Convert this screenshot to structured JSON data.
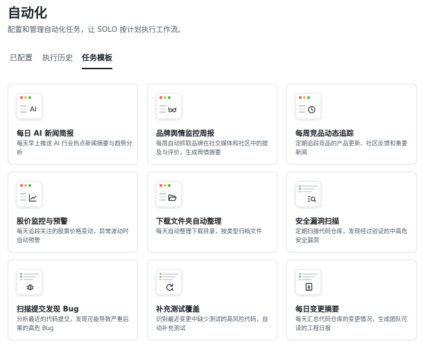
{
  "page": {
    "title": "自动化",
    "description": "配置和管理自动化任务，让 SOLO 按计划执行工作流。"
  },
  "tabs": [
    {
      "label": "已配置",
      "active": false
    },
    {
      "label": "执行历史",
      "active": false
    },
    {
      "label": "任务模板",
      "active": true
    }
  ],
  "templates": [
    {
      "title": "每日 AI 新闻简报",
      "description": "每天早上推送 AI 行业热点新闻摘要与趋势分析",
      "icon": "ai-text-icon",
      "icon_text": "AI"
    },
    {
      "title": "品牌舆情监控周报",
      "description": "每周自动抓取品牌在社交媒体和社区中的提及与评价，生成舆情摘要",
      "icon": "glasses-icon"
    },
    {
      "title": "每周竞品动态追踪",
      "description": "定期追踪竞品的产品更新、社区反馈和重要新闻",
      "icon": "target-icon"
    },
    {
      "title": "股价监控与预警",
      "description": "每天追踪关注的股票价格变动，异常波动时自动预警",
      "icon": "chart-line-icon"
    },
    {
      "title": "下载文件夹自动整理",
      "description": "每天自动整理下载目录，按类型归档文件",
      "icon": "folder-icon"
    },
    {
      "title": "安全漏洞扫描",
      "description": "定期扫描代码仓库，发现经过验证的中高危安全漏洞",
      "icon": "search-list-icon"
    },
    {
      "title": "扫描提交发现 Bug",
      "description": "分析最近的代码提交，发现可能导致严重后果的高危 Bug",
      "icon": "bug-icon"
    },
    {
      "title": "补充测试覆盖",
      "description": "识别最近变更中缺少测试的高风险代码，自动补充测试",
      "icon": "refresh-icon"
    },
    {
      "title": "每日变更摘要",
      "description": "每天汇总代码仓库的变更情况，生成团队可读的工程日报",
      "icon": "document-icon"
    }
  ],
  "colors": {
    "window_red": "#f25f58",
    "window_yellow": "#f9b937",
    "window_green": "#3ec253",
    "accent_blue": "#3b82f6",
    "border": "#e4e6ea"
  }
}
